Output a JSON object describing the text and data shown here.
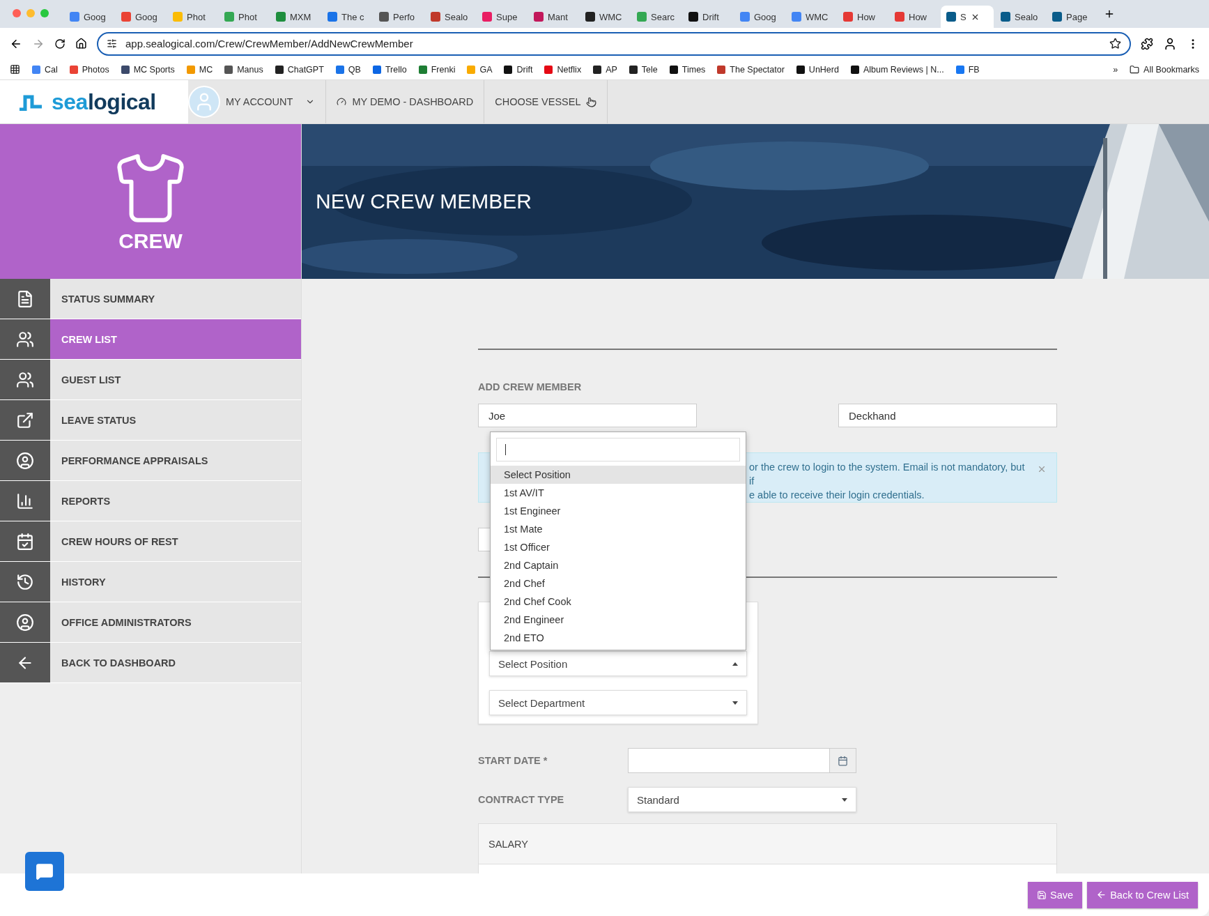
{
  "browser": {
    "tabs": [
      {
        "title": "Goog",
        "selected": false
      },
      {
        "title": "Goog",
        "selected": false
      },
      {
        "title": "Phot",
        "selected": false
      },
      {
        "title": "Phot",
        "selected": false
      },
      {
        "title": "MXM",
        "selected": false
      },
      {
        "title": "The c",
        "selected": false
      },
      {
        "title": "Perfo",
        "selected": false
      },
      {
        "title": "Sealo",
        "selected": false
      },
      {
        "title": "Supe",
        "selected": false
      },
      {
        "title": "Mant",
        "selected": false
      },
      {
        "title": "WMC",
        "selected": false
      },
      {
        "title": "Searc",
        "selected": false
      },
      {
        "title": "Drift",
        "selected": false
      },
      {
        "title": "Goog",
        "selected": false
      },
      {
        "title": "WMC",
        "selected": false
      },
      {
        "title": "How",
        "selected": false
      },
      {
        "title": "How",
        "selected": false
      },
      {
        "title": "S",
        "selected": true
      },
      {
        "title": "Sealo",
        "selected": false
      },
      {
        "title": "Page",
        "selected": false
      }
    ],
    "url": "app.sealogical.com/Crew/CrewMember/AddNewCrewMember",
    "bookmarks": [
      {
        "label": "Cal",
        "color": "#4285f4"
      },
      {
        "label": "Photos",
        "color": "#ea4335"
      },
      {
        "label": "MC Sports",
        "color": "#3c4a6b"
      },
      {
        "label": "MC",
        "color": "#f29900"
      },
      {
        "label": "Manus",
        "color": "#555555"
      },
      {
        "label": "ChatGPT",
        "color": "#222222"
      },
      {
        "label": "QB",
        "color": "#1a73e8"
      },
      {
        "label": "Trello",
        "color": "#0c66e4"
      },
      {
        "label": "Frenki",
        "color": "#1e7e34"
      },
      {
        "label": "GA",
        "color": "#f9ab00"
      },
      {
        "label": "Drift",
        "color": "#111111"
      },
      {
        "label": "Netflix",
        "color": "#e50914"
      },
      {
        "label": "AP",
        "color": "#222222"
      },
      {
        "label": "Tele",
        "color": "#222222"
      },
      {
        "label": "Times",
        "color": "#111111"
      },
      {
        "label": "The Spectator",
        "color": "#c0392b"
      },
      {
        "label": "UnHerd",
        "color": "#111111"
      },
      {
        "label": "Album Reviews | N...",
        "color": "#111111"
      },
      {
        "label": "FB",
        "color": "#1877f2"
      }
    ],
    "bookmarks_more": "»",
    "all_bookmarks": "All Bookmarks"
  },
  "app": {
    "logo": {
      "part_1": "sea",
      "part_2": "logical"
    },
    "nav": [
      {
        "label": "MY ACCOUNT",
        "kind": "account"
      },
      {
        "label": "MY DEMO - DASHBOARD",
        "kind": "dashboard"
      },
      {
        "label": "CHOOSE VESSEL",
        "kind": "vessel"
      }
    ]
  },
  "sidebar": {
    "title": "CREW",
    "items": [
      {
        "label": "STATUS SUMMARY",
        "selected": false
      },
      {
        "label": "CREW LIST",
        "selected": true
      },
      {
        "label": "GUEST LIST",
        "selected": false
      },
      {
        "label": "LEAVE STATUS",
        "selected": false
      },
      {
        "label": "PERFORMANCE APPRAISALS",
        "selected": false
      },
      {
        "label": "REPORTS",
        "selected": false
      },
      {
        "label": "CREW HOURS OF REST",
        "selected": false
      },
      {
        "label": "HISTORY",
        "selected": false
      },
      {
        "label": "OFFICE ADMINISTRATORS",
        "selected": false
      },
      {
        "label": "BACK TO DASHBOARD",
        "selected": false
      }
    ]
  },
  "hero": {
    "title": "NEW CREW MEMBER"
  },
  "form": {
    "section_title": "ADD CREW MEMBER",
    "first_name": "Joe",
    "position_name": "Deckhand",
    "info_lines": [
      "or the crew to login to the system. Email is not mandatory, but if",
      "e able to receive their login credentials."
    ],
    "position_select": {
      "value": "Select Position",
      "expanded": true
    },
    "department_select": {
      "value": "Select Department"
    },
    "dropdown": {
      "options": [
        {
          "label": "Select Position",
          "selected": true
        },
        {
          "label": "1st AV/IT",
          "selected": false
        },
        {
          "label": "1st Engineer",
          "selected": false
        },
        {
          "label": "1st Mate",
          "selected": false
        },
        {
          "label": "1st Officer",
          "selected": false
        },
        {
          "label": "2nd Captain",
          "selected": false
        },
        {
          "label": "2nd Chef",
          "selected": false
        },
        {
          "label": "2nd Chef Cook",
          "selected": false
        },
        {
          "label": "2nd Engineer",
          "selected": false
        },
        {
          "label": "2nd ETO",
          "selected": false
        }
      ]
    },
    "start_date_label": "START DATE *",
    "contract_type_label": "CONTRACT TYPE",
    "contract_type": "Standard",
    "salary_title": "SALARY"
  },
  "footer": {
    "buttons": [
      {
        "label": "Save",
        "kind": "save"
      },
      {
        "label": "Back to Crew List",
        "kind": "back"
      }
    ]
  }
}
